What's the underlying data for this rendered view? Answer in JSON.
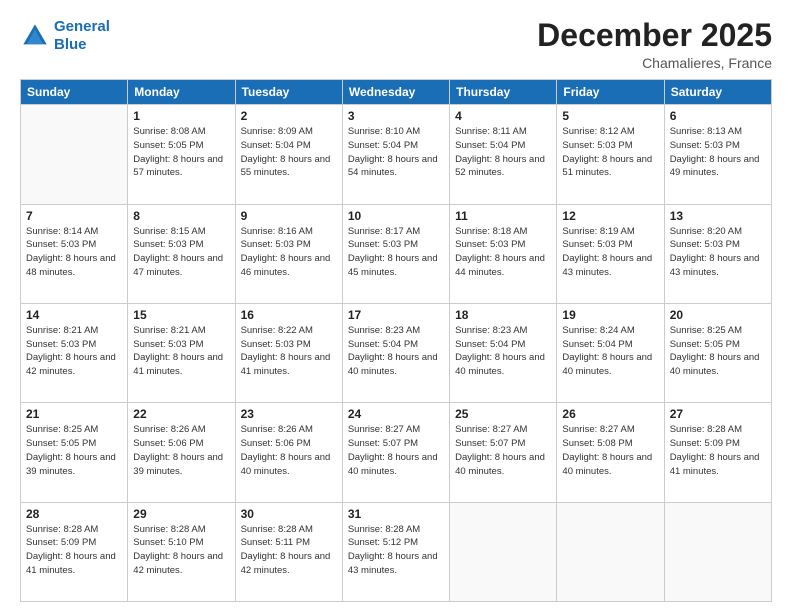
{
  "header": {
    "logo_line1": "General",
    "logo_line2": "Blue",
    "main_title": "December 2025",
    "subtitle": "Chamalieres, France"
  },
  "calendar": {
    "weekdays": [
      "Sunday",
      "Monday",
      "Tuesday",
      "Wednesday",
      "Thursday",
      "Friday",
      "Saturday"
    ],
    "weeks": [
      [
        {
          "day": "",
          "info": ""
        },
        {
          "day": "1",
          "info": "Sunrise: 8:08 AM\nSunset: 5:05 PM\nDaylight: 8 hours\nand 57 minutes."
        },
        {
          "day": "2",
          "info": "Sunrise: 8:09 AM\nSunset: 5:04 PM\nDaylight: 8 hours\nand 55 minutes."
        },
        {
          "day": "3",
          "info": "Sunrise: 8:10 AM\nSunset: 5:04 PM\nDaylight: 8 hours\nand 54 minutes."
        },
        {
          "day": "4",
          "info": "Sunrise: 8:11 AM\nSunset: 5:04 PM\nDaylight: 8 hours\nand 52 minutes."
        },
        {
          "day": "5",
          "info": "Sunrise: 8:12 AM\nSunset: 5:03 PM\nDaylight: 8 hours\nand 51 minutes."
        },
        {
          "day": "6",
          "info": "Sunrise: 8:13 AM\nSunset: 5:03 PM\nDaylight: 8 hours\nand 49 minutes."
        }
      ],
      [
        {
          "day": "7",
          "info": "Sunrise: 8:14 AM\nSunset: 5:03 PM\nDaylight: 8 hours\nand 48 minutes."
        },
        {
          "day": "8",
          "info": "Sunrise: 8:15 AM\nSunset: 5:03 PM\nDaylight: 8 hours\nand 47 minutes."
        },
        {
          "day": "9",
          "info": "Sunrise: 8:16 AM\nSunset: 5:03 PM\nDaylight: 8 hours\nand 46 minutes."
        },
        {
          "day": "10",
          "info": "Sunrise: 8:17 AM\nSunset: 5:03 PM\nDaylight: 8 hours\nand 45 minutes."
        },
        {
          "day": "11",
          "info": "Sunrise: 8:18 AM\nSunset: 5:03 PM\nDaylight: 8 hours\nand 44 minutes."
        },
        {
          "day": "12",
          "info": "Sunrise: 8:19 AM\nSunset: 5:03 PM\nDaylight: 8 hours\nand 43 minutes."
        },
        {
          "day": "13",
          "info": "Sunrise: 8:20 AM\nSunset: 5:03 PM\nDaylight: 8 hours\nand 43 minutes."
        }
      ],
      [
        {
          "day": "14",
          "info": "Sunrise: 8:21 AM\nSunset: 5:03 PM\nDaylight: 8 hours\nand 42 minutes."
        },
        {
          "day": "15",
          "info": "Sunrise: 8:21 AM\nSunset: 5:03 PM\nDaylight: 8 hours\nand 41 minutes."
        },
        {
          "day": "16",
          "info": "Sunrise: 8:22 AM\nSunset: 5:03 PM\nDaylight: 8 hours\nand 41 minutes."
        },
        {
          "day": "17",
          "info": "Sunrise: 8:23 AM\nSunset: 5:04 PM\nDaylight: 8 hours\nand 40 minutes."
        },
        {
          "day": "18",
          "info": "Sunrise: 8:23 AM\nSunset: 5:04 PM\nDaylight: 8 hours\nand 40 minutes."
        },
        {
          "day": "19",
          "info": "Sunrise: 8:24 AM\nSunset: 5:04 PM\nDaylight: 8 hours\nand 40 minutes."
        },
        {
          "day": "20",
          "info": "Sunrise: 8:25 AM\nSunset: 5:05 PM\nDaylight: 8 hours\nand 40 minutes."
        }
      ],
      [
        {
          "day": "21",
          "info": "Sunrise: 8:25 AM\nSunset: 5:05 PM\nDaylight: 8 hours\nand 39 minutes."
        },
        {
          "day": "22",
          "info": "Sunrise: 8:26 AM\nSunset: 5:06 PM\nDaylight: 8 hours\nand 39 minutes."
        },
        {
          "day": "23",
          "info": "Sunrise: 8:26 AM\nSunset: 5:06 PM\nDaylight: 8 hours\nand 40 minutes."
        },
        {
          "day": "24",
          "info": "Sunrise: 8:27 AM\nSunset: 5:07 PM\nDaylight: 8 hours\nand 40 minutes."
        },
        {
          "day": "25",
          "info": "Sunrise: 8:27 AM\nSunset: 5:07 PM\nDaylight: 8 hours\nand 40 minutes."
        },
        {
          "day": "26",
          "info": "Sunrise: 8:27 AM\nSunset: 5:08 PM\nDaylight: 8 hours\nand 40 minutes."
        },
        {
          "day": "27",
          "info": "Sunrise: 8:28 AM\nSunset: 5:09 PM\nDaylight: 8 hours\nand 41 minutes."
        }
      ],
      [
        {
          "day": "28",
          "info": "Sunrise: 8:28 AM\nSunset: 5:09 PM\nDaylight: 8 hours\nand 41 minutes."
        },
        {
          "day": "29",
          "info": "Sunrise: 8:28 AM\nSunset: 5:10 PM\nDaylight: 8 hours\nand 42 minutes."
        },
        {
          "day": "30",
          "info": "Sunrise: 8:28 AM\nSunset: 5:11 PM\nDaylight: 8 hours\nand 42 minutes."
        },
        {
          "day": "31",
          "info": "Sunrise: 8:28 AM\nSunset: 5:12 PM\nDaylight: 8 hours\nand 43 minutes."
        },
        {
          "day": "",
          "info": ""
        },
        {
          "day": "",
          "info": ""
        },
        {
          "day": "",
          "info": ""
        }
      ]
    ]
  }
}
